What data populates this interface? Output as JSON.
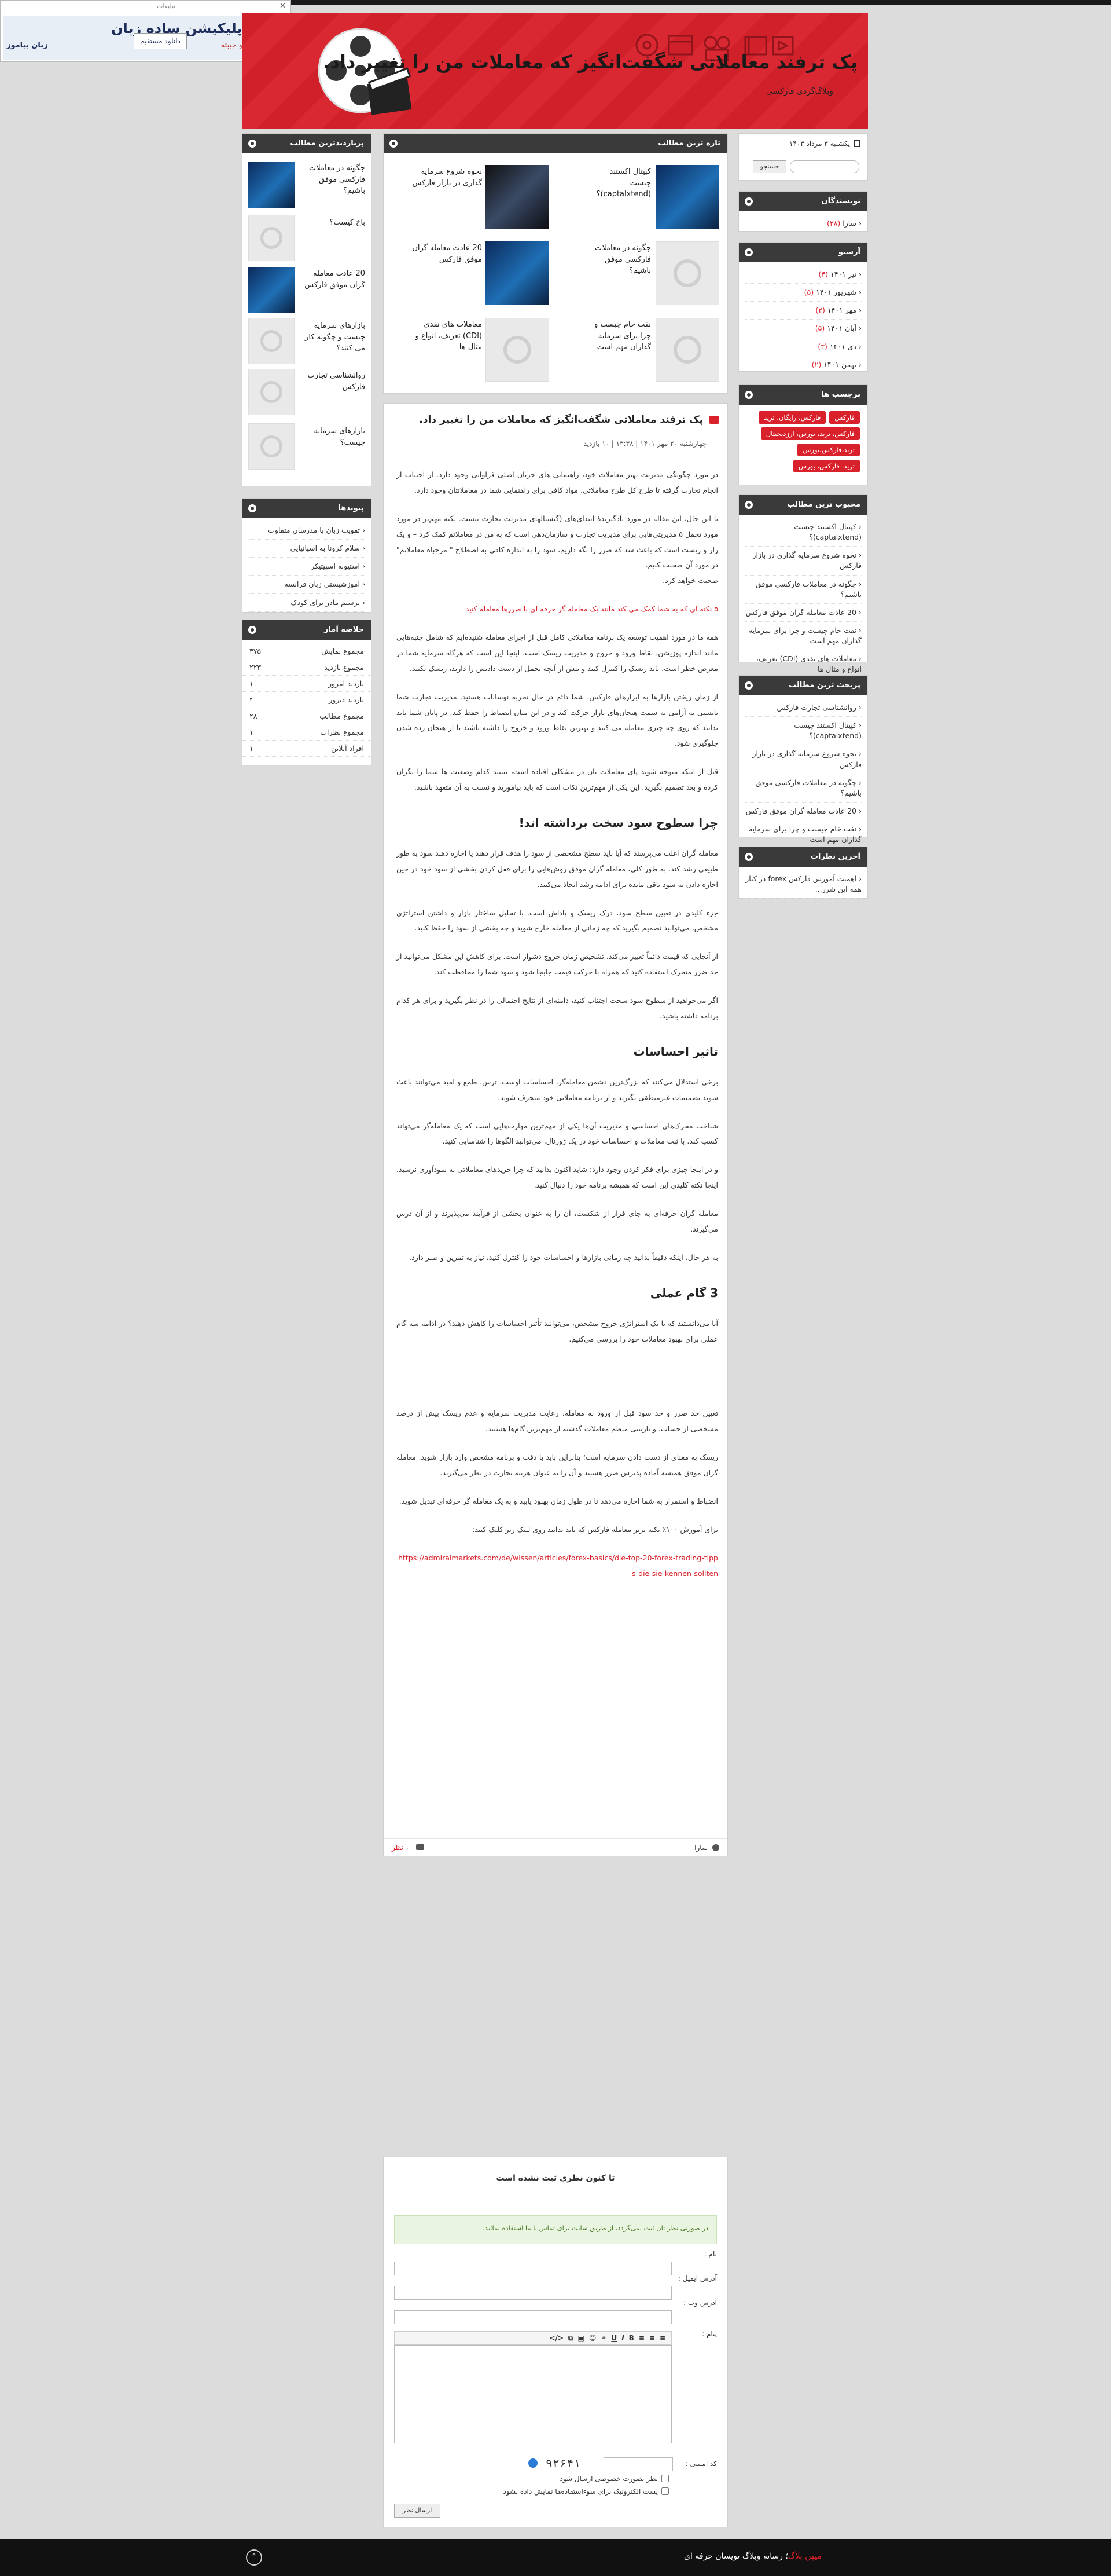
{
  "ad": {
    "label": "تبلیغات",
    "title": "با یه اپلیکیشن ساده زبان",
    "subtitle": "مدرسه ات تو جیبته",
    "button": "دانلود مستقیم",
    "brand": "زبان بیاموز"
  },
  "header": {
    "title": "پک ترفند معاملاتی شگفت‌انگیز که معاملات من را تغییر داد.",
    "subtitle": "وبلاگ‌گردی فارکسی"
  },
  "search": {
    "date": "یکشنبه ۳ مرداد ۱۴۰۳",
    "button": "جستجو"
  },
  "authors": {
    "title": "نویسندگان",
    "items": [
      {
        "label": "سارا",
        "count": "(۳۸)"
      }
    ]
  },
  "archive": {
    "title": "آرشیو",
    "items": [
      {
        "label": "تیر ۱۴۰۱",
        "count": "(۴)"
      },
      {
        "label": "شهریور ۱۴۰۱",
        "count": "(۵)"
      },
      {
        "label": "مهر ۱۴۰۱",
        "count": "(۲)"
      },
      {
        "label": "آبان ۱۴۰۱",
        "count": "(۵)"
      },
      {
        "label": "دی ۱۴۰۱",
        "count": "(۳)"
      },
      {
        "label": "بهمن ۱۴۰۱",
        "count": "(۲)"
      }
    ]
  },
  "tags": {
    "title": "برچسب ها",
    "items": [
      "فارکس",
      "فارکس، رایگان، ترید",
      "فارکس، ترید، بورس، ارزدیجیتال",
      "ترید،فارکس،بورس",
      "ترید، فارکس، بورس"
    ]
  },
  "popular": {
    "title": "محبوب ترین مطالب",
    "items": [
      "کپیتال اکستند چیست (captalxtend)؟",
      "نحوه شروع سرمایه گذاری در بازار فارکس",
      "چگونه در معاملات فارکسی موفق باشیم؟",
      "20 عادت معامله گران موفق فارکس",
      "نفت خام چیست و چرا برای سرمایه گذاران مهم است",
      "معاملات های نقدی (CDI) تعریف، انواع و مثال ها"
    ]
  },
  "most_visited": {
    "title": "پربحث ترین مطالب",
    "items": [
      "روانشناسی تجارت فارکس",
      "کپیتال اکستند چیست (captalxtend)؟",
      "نحوه شروع سرمایه گذاری در بازار فارکس",
      "چگونه در معاملات فارکسی موفق باشیم؟",
      "20 عادت معامله گران موفق فارکس",
      "نفت خام چیست و چرا برای سرمایه گذاران مهم است"
    ]
  },
  "latest_comments": {
    "title": "آخرین نظرات",
    "items": [
      "اهمیت آموزش فارکس forex در کنار همه این شرر..."
    ]
  },
  "newest": {
    "title": "تازه ترین مطالب",
    "items": [
      "کپیتال اکستند چیست (captalxtend)؟",
      "نحوه شروع سرمایه گذاری در بازار فارکس",
      "چگونه در معاملات فارکسی موفق باشیم؟",
      "20 عادت معامله گران موفق فارکس",
      "نفت خام چیست و چرا برای سرمایه گذاران مهم است",
      "معاملات های نقدی (CDI) تعریف، انواع و مثال ها"
    ]
  },
  "left_popular": {
    "title": "پربازدیدترین مطالب",
    "items": [
      "چگونه در معاملات فارکسی موفق باشیم؟",
      "باخ کیست؟",
      "20 عادت معامله گران موفق فارکس",
      "بازارهای سرمایه چیست و چگونه کار می کنند؟",
      "روانشناسی تجارت فارکس",
      "بازارهای سرمایه چیست؟"
    ]
  },
  "links": {
    "title": "پیوندها",
    "items": [
      "تقویت زبان با مدرسان متفاوت",
      "سلام کرونا به اسپانیایی",
      "استیونه اسپیتیکر",
      "اموزشیستی زبان فرانسه",
      "ترسیم مادر برای کودک"
    ]
  },
  "stats": {
    "title": "خلاصه آمار",
    "rows": [
      {
        "label": "مجموع نمایش",
        "value": "۳۷۵"
      },
      {
        "label": "مجموع بازدید",
        "value": "۲۲۳"
      },
      {
        "label": "بازدید امروز",
        "value": "۱"
      },
      {
        "label": "بازدید دیروز",
        "value": "۴"
      },
      {
        "label": "مجموع مطالب",
        "value": "۲۸"
      },
      {
        "label": "مجموع نظرات",
        "value": "۱"
      },
      {
        "label": "افراد آنلاین",
        "value": "۱"
      }
    ]
  },
  "post": {
    "title": "پک ترفند معاملاتی شگفت‌انگیز که معاملات من را تغییر داد.",
    "meta": "چهارشنبه ۲۰ مهر ۱۴۰۱ | ۱۳:۳۸ | ۱۰ بازدید",
    "p1": "در مورد چگونگی مدیریت بهتر معاملات خود، راهنمایی های جریان اصلی فراوانی وجود دارد. از اجتناب از انجام تجارت گرفته تا طرح کل طرح معاملاتی، مواد کافی برای راهنمایی شما در معاملاتتان وجود دارد.",
    "p2": "با این حال، این مقاله در مورد یادگیرندهٔ ابتدای‌های (گیسنالهای مدیریت تجارت نیست. نکته مهم‌تر در مورد مورد تحمل ۵ مدیریتی‌هایی برای مدیریت تجارت و سازمان‌دهی است که به من در معاملاتم کمک کرد – و یک راز و زیست است که باعث شد که ضرر را نگه داریم، سود را به اندازه کافی به اصطلاح \" مرحباه معاملاتم\" در مورد آن صحبت کنیم.\nصحبت خواهد کرد.",
    "quote": "۵ نکته ای که به شما کمک می کند مانند یک معامله گر حرفه ای با ضررها معامله کنید",
    "p3": "همه ما در مورد اهمیت توسعه یک برنامه معاملاتی کامل قبل از اجرای معامله شنیده‌ایم که شامل جنبه‌هایی مانند اندازه پوزیشن، نقاط ورود و خروج و مدیریت ریسک است. اینجا این است که هرگاه سرمایه شما در معرض خطر است، باید ریسک را کنترل کنید و بیش از آنچه تحمل از دست دادنش را دارید، ریسک نکنید.",
    "p4": "از زمان ریختن بازارها به ابزارهای فارکس، شما دائم در حال تجربه نوسانات هستید. مدیریت تجارت شما بایستی به آرامی به سمت هیجان‌های بازار حرکت کند و در این میان انضباط را حفظ کند. در پایان شما باید بدانید که روی چه چیزی معامله می کنید و بهترین نقاط ورود و خروج را داشته باشید تا از هیجان زده شدن جلوگیری شود.",
    "p5": "قبل از اینکه متوجه شوید پای معاملات تان در مشکلی افتاده است، ببینید کدام وضعیت ها شما را نگران کرده و بعد تصمیم بگیرید. این یکی از مهم‌ترین نکات است که باید بیاموزید و نسبت به آن متعهد باشید.",
    "h1": "چرا سطوح سود سخت برداشته اند!",
    "p6": "معامله گران اغلب می‌پرسند که آیا باید سطح مشخصی از سود را هدف قرار دهند یا اجازه دهند سود به طور طبیعی رشد کند. به طور کلی، معامله گران موفق روش‌هایی را برای قفل کردن بخشی از سود خود در حین اجازه دادن به سود باقی مانده برای ادامه رشد اتخاذ می‌کنند.",
    "p7": "جزء کلیدی در تعیین سطح سود، درک ریسک و پاداش است. با تحلیل ساختار بازار و داشتن استراتژی مشخص، می‌توانید تصمیم بگیرید که چه زمانی از معامله خارج شوید و چه بخشی از سود را حفظ کنید.",
    "p8": "از آنجایی که قیمت دائماً تغییر می‌کند، تشخیص زمان خروج دشوار است. برای کاهش این مشکل می‌توانید از حد ضرر متحرک استفاده کنید که همراه با حرکت قیمت جابجا شود و سود شما را محافظت کند.",
    "p9": "اگر می‌خواهید از سطوح سود سخت اجتناب کنید، دامنه‌ای از نتایج احتمالی را در نظر بگیرید و برای هر کدام برنامه داشته باشید.",
    "h2": "تاثیر احساسات",
    "p10": "برخی استدلال می‌کنند که بزرگ‌ترین دشمن معامله‌گر، احساسات اوست. ترس، طمع و امید می‌توانند باعث شوند تصمیمات غیرمنطقی بگیرید و از برنامه معاملاتی خود منحرف شوید.",
    "p11": "شناخت محرک‌های احساسی و مدیریت آن‌ها یکی از مهم‌ترین مهارت‌هایی است که یک معامله‌گر می‌تواند کسب کند. با ثبت معاملات و احساسات خود در یک ژورنال، می‌توانید الگوها را شناسایی کنید.",
    "p12": "و در اینجا چیزی برای فکر کردن وجود دارد: شاید اکنون بدانید که چرا خریدهای معاملاتی به سودآوری نرسید. اینجا نکته کلیدی این است که همیشه برنامه خود را دنبال کنید.",
    "p13": "معامله گران حرفه‌ای به جای فرار از شکست، آن را به عنوان بخشی از فرآیند می‌پذیرند و از آن درس می‌گیرند.",
    "p14": "به هر حال، اینکه دقیقاً بدانید چه زمانی بازارها و احساسات خود را کنترل کنید، نیاز به تمرین و صبر دارد.",
    "h3": "3 گام عملی",
    "p15": "آیا می‌دانستید که با یک استراتژی خروج مشخص، می‌توانید تأثیر احساسات را کاهش دهید؟ در ادامه سه گام عملی برای بهبود معاملات خود را بررسی می‌کنیم.",
    "p16": "تعیین حد ضرر و حد سود قبل از ورود به معامله، رعایت مدیریت سرمایه و عدم ریسک بیش از درصد مشخصی از حساب، و بازبینی منظم معاملات گذشته از مهم‌ترین گام‌ها هستند.",
    "p17": "ریسک به معنای از دست دادن سرمایه است؛ بنابراین باید با دقت و برنامه مشخص وارد بازار شوید. معامله گران موفق همیشه آماده پذیرش ضرر هستند و آن را به عنوان هزینه تجارت در نظر می‌گیرند.",
    "p18": "انضباط و استمرار به شما اجازه می‌دهد تا در طول زمان بهبود یابید و به یک معامله گر حرفه‌ای تبدیل شوید.",
    "p19": "برای آموزش ۱۰۰٪ نکته برتر معامله فارکس که باید بدانید روی لینک زیر کلیک کنید:",
    "link": "https://admiralmarkets.com/de/wissen/articles/forex-basics/die-top-20-forex-trading-tipps-die-sie-kennen-sollten",
    "author": "سارا",
    "comments": "۰ نظر"
  },
  "newest_posts_grid": [
    {
      "title": "کپیتال اکستند چیست (captalxtend)؟"
    },
    {
      "title": "نحوه شروع سرمایه گذاری در بازار فارکس"
    },
    {
      "title": "چگونه در معاملات فارکسی موفق باشیم؟"
    },
    {
      "title": "20 عادت معامله گران موفق فارکس"
    },
    {
      "title": "نفت خام چیست و چرا برای سرمایه گذاران مهم است"
    },
    {
      "title": "معاملات های نقدی (CDI) تعریف، انواع و مثال ها"
    }
  ],
  "comment_form": {
    "title": "تا کنون نظری ثبت نشده است",
    "notice": "در صورتی نظر تان ثبت نمی‌گردد، از طریق سایت برای تماس با ما استفاده نمائید.",
    "name_label": "نام :",
    "email_label": "آدرس ایمیل :",
    "site_label": "آدرس وب :",
    "message_label": "پیام :",
    "captcha_label": "کد امنیتی :",
    "captcha": "۹۲۶۴۱",
    "check1": "نظر بصورت خصوصی ارسال شود",
    "check2": "پست الکترونیک برای سوءاستفاده‌ها نمایش داده نشود",
    "submit": "ارسال نظر"
  },
  "footer": {
    "brand": "میهن بلاگ",
    "text": "؛ رسانه وبلاگ نویسان حرفه ای"
  }
}
